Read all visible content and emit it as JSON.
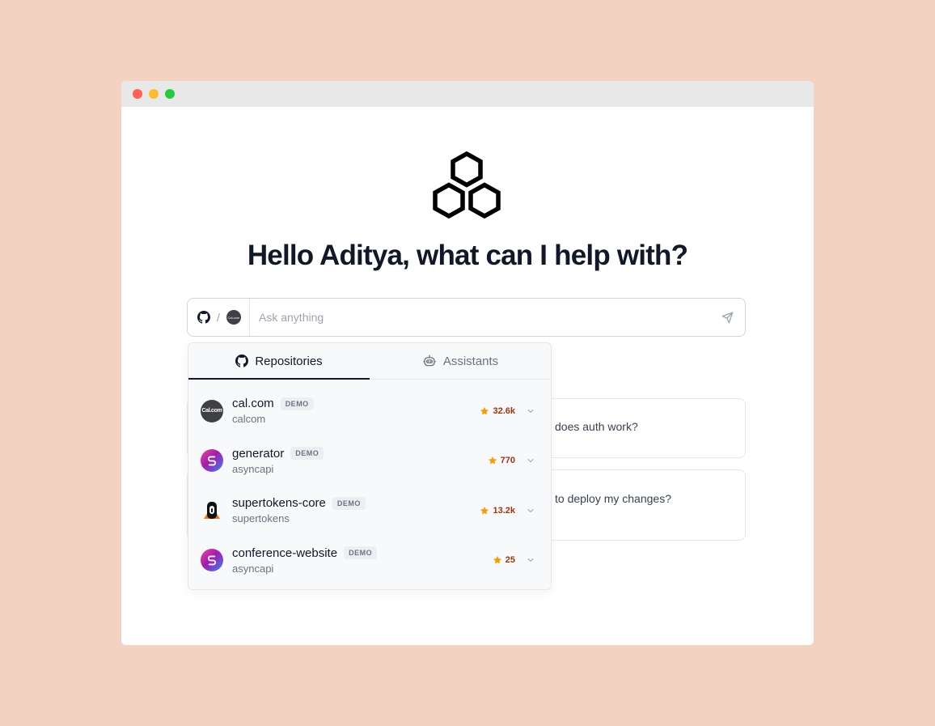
{
  "headline": "Hello Aditya, what can I help with?",
  "ask": {
    "placeholder": "Ask anything",
    "context_separator": "/",
    "context_avatar_text": "Cal.com"
  },
  "tabs": [
    {
      "label": "Repositories",
      "icon": "github-icon",
      "active": true
    },
    {
      "label": "Assistants",
      "icon": "robot-icon",
      "active": false
    }
  ],
  "repositories": [
    {
      "name": "cal.com",
      "badge": "DEMO",
      "owner": "calcom",
      "stars": "32.6k",
      "avatar": "calcom",
      "avatar_text": "Cal.com"
    },
    {
      "name": "generator",
      "badge": "DEMO",
      "owner": "asyncapi",
      "stars": "770",
      "avatar": "asyncapi"
    },
    {
      "name": "supertokens-core",
      "badge": "DEMO",
      "owner": "supertokens",
      "stars": "13.2k",
      "avatar": "supertokens"
    },
    {
      "name": "conference-website",
      "badge": "DEMO",
      "owner": "asyncapi",
      "stars": "25",
      "avatar": "asyncapi"
    }
  ],
  "suggestions": [
    {
      "text": "does auth work?"
    },
    {
      "text": "to deploy my changes?"
    }
  ],
  "colors": {
    "background": "#f3d2c1",
    "star": "#f59e0b",
    "star_text": "#9a3412"
  }
}
